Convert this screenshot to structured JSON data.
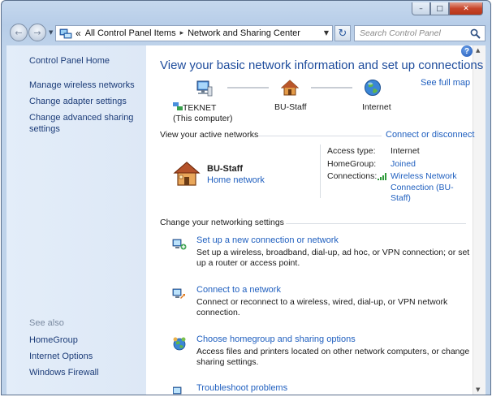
{
  "window": {
    "minimize": "–",
    "maximize": "□",
    "close": "✕"
  },
  "navigation": {
    "back": "←",
    "forward": "→",
    "history_dropdown": "▼",
    "address": {
      "chevron": "«",
      "segments": [
        "All Control Panel Items",
        "Network and Sharing Center"
      ],
      "separator": "▸",
      "dropdown": "▼"
    },
    "refresh": "↻",
    "search_placeholder": "Search Control Panel"
  },
  "sidebar": {
    "home": "Control Panel Home",
    "links": [
      "Manage wireless networks",
      "Change adapter settings",
      "Change advanced sharing settings"
    ],
    "see_also_label": "See also",
    "see_also": [
      "HomeGroup",
      "Internet Options",
      "Windows Firewall"
    ]
  },
  "main": {
    "help": "?",
    "title": "View your basic network information and set up connections",
    "see_full_map": "See full map",
    "map": {
      "computer_name": "TEKNET",
      "computer_sub": "(This computer)",
      "network": "BU-Staff",
      "internet": "Internet"
    },
    "active_networks_label": "View your active networks",
    "connect_disconnect": "Connect or disconnect",
    "active_network": {
      "name": "BU-Staff",
      "type": "Home network"
    },
    "details": {
      "access_type_key": "Access type:",
      "access_type_val": "Internet",
      "homegroup_key": "HomeGroup:",
      "homegroup_val": "Joined",
      "connections_key": "Connections:",
      "connections_val": "Wireless Network Connection (BU-Staff)"
    },
    "change_settings_label": "Change your networking settings",
    "tasks": [
      {
        "link": "Set up a new connection or network",
        "desc": "Set up a wireless, broadband, dial-up, ad hoc, or VPN connection; or set up a router or access point."
      },
      {
        "link": "Connect to a network",
        "desc": "Connect or reconnect to a wireless, wired, dial-up, or VPN network connection."
      },
      {
        "link": "Choose homegroup and sharing options",
        "desc": "Access files and printers located on other network computers, or change sharing settings."
      },
      {
        "link": "Troubleshoot problems",
        "desc": ""
      }
    ],
    "scroll_up": "▲",
    "scroll_down": "▼"
  }
}
